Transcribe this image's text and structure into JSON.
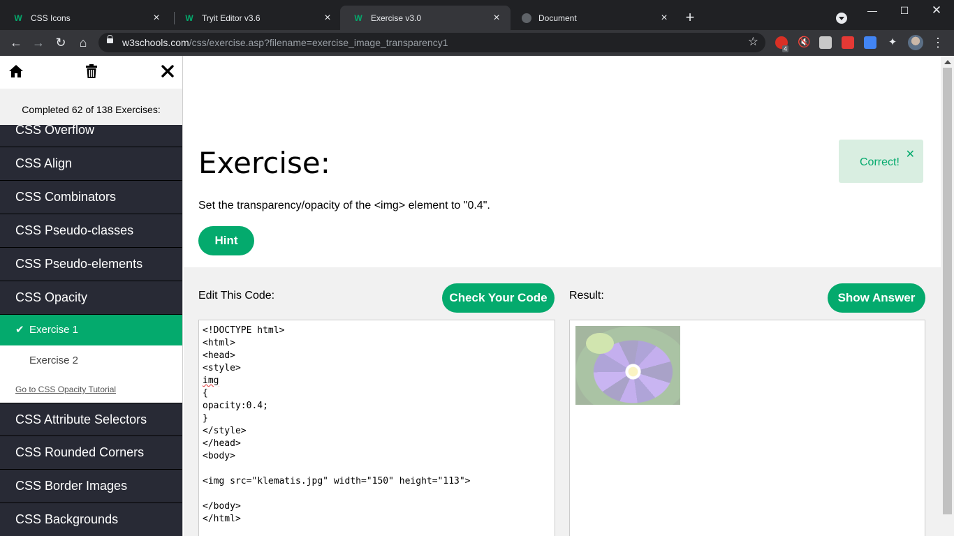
{
  "browser": {
    "tabs": [
      {
        "title": "CSS Icons",
        "icon": "w3schools-favicon"
      },
      {
        "title": "Tryit Editor v3.6",
        "icon": "w3schools-favicon"
      },
      {
        "title": "Exercise v3.0",
        "icon": "w3schools-favicon",
        "active": true
      },
      {
        "title": "Document",
        "icon": "globe-icon"
      }
    ],
    "url_host": "w3schools.com",
    "url_path": "/css/exercise.asp?filename=exercise_image_transparency1",
    "favicon_letter": "W",
    "extension_badge": "4"
  },
  "sidebar": {
    "progress_text": "Completed 62 of 138 Exercises:",
    "items_before": [
      "CSS Overflow",
      "CSS Align",
      "CSS Combinators",
      "CSS Pseudo-classes",
      "CSS Pseudo-elements",
      "CSS Opacity"
    ],
    "exercise_1": "Exercise 1",
    "exercise_2": "Exercise 2",
    "tutorial_link": "Go to CSS Opacity Tutorial",
    "items_after": [
      "CSS Attribute Selectors",
      "CSS Rounded Corners",
      "CSS Border Images",
      "CSS Backgrounds"
    ]
  },
  "main": {
    "title": "Exercise:",
    "instruction": "Set the transparency/opacity of the <img> element to \"0.4\".",
    "hint_label": "Hint",
    "toast": "Correct!",
    "edit_label": "Edit This Code:",
    "check_label": "Check Your Code",
    "result_label": "Result:",
    "answer_label": "Show Answer",
    "code_lines": [
      "<!DOCTYPE html>",
      "<html>",
      "<head>",
      "<style>",
      "img",
      "{",
      "opacity:0.4;",
      "}",
      "</style>",
      "</head>",
      "<body>",
      "",
      "<img src=\"klematis.jpg\" width=\"150\" height=\"113\">",
      "",
      "</body>",
      "</html>"
    ]
  },
  "colors": {
    "accent": "#04aa6d",
    "sidebar_bg": "#282a35",
    "toast_bg": "#d9eee1"
  }
}
